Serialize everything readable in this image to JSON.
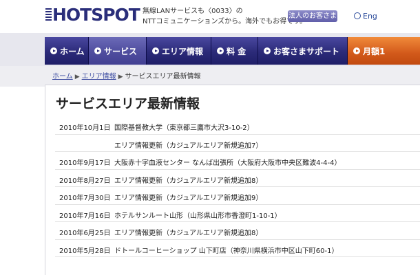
{
  "header": {
    "logo_text": "HOTSPOT",
    "tagline_line1": "無線LANサービスも〈0033〉の",
    "tagline_line2": "NTTコミュニケーションズから。海外でもお得です。",
    "corp_button": "法人のお客さま",
    "lang_label": "Eng"
  },
  "nav": {
    "items": [
      {
        "label": "ホーム",
        "icon": "arrow-circle-icon"
      },
      {
        "label": "サービス",
        "icon": "arrow-circle-icon"
      },
      {
        "label": "エリア情報",
        "icon": "arrow-circle-icon"
      },
      {
        "label": "料 金",
        "icon": "arrow-circle-icon"
      },
      {
        "label": "お客さまサポート",
        "icon": "arrow-circle-icon"
      },
      {
        "label": "月額1",
        "icon": "arrow-circle-icon"
      }
    ],
    "active_index": 1,
    "accent_color": "#d2591a",
    "nav_color": "#2b2a78"
  },
  "breadcrumb": {
    "items": [
      "ホーム",
      "エリア情報",
      "サービスエリア最新情報"
    ]
  },
  "main": {
    "title": "サービスエリア最新情報",
    "news": [
      {
        "date": "2010年10月1日",
        "text": "国際基督教大学（東京都三鷹市大沢3-10-2）"
      },
      {
        "date": "",
        "text": "エリア情報更新（カジュアルエリア新規追加7）"
      },
      {
        "date": "2010年9月17日",
        "text": "大阪赤十字血液センター なんば出張所（大阪府大阪市中央区難波4-4-4）"
      },
      {
        "date": "2010年8月27日",
        "text": "エリア情報更新（カジュアルエリア新規追加8）"
      },
      {
        "date": "2010年7月30日",
        "text": "エリア情報更新（カジュアルエリア新規追加9）"
      },
      {
        "date": "2010年7月16日",
        "text": "ホテルサンルート山形（山形県山形市香澄町1-10-1）"
      },
      {
        "date": "2010年6月25日",
        "text": "エリア情報更新（カジュアルエリア新規追加8）"
      },
      {
        "date": "2010年5月28日",
        "text": "ドトールコーヒーショップ 山下町店（神奈川県横浜市中区山下町60-1）"
      }
    ]
  }
}
